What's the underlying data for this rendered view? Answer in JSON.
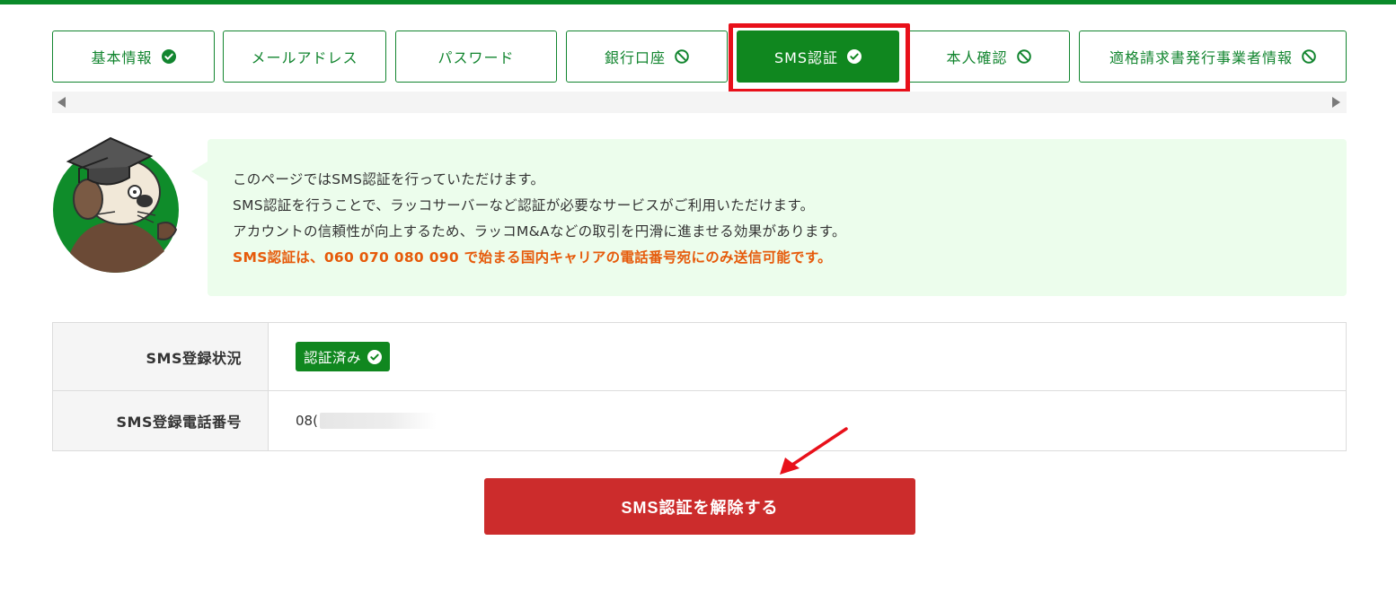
{
  "tabs": [
    {
      "label": "基本情報",
      "status": "check-circle-icon"
    },
    {
      "label": "メールアドレス",
      "status": ""
    },
    {
      "label": "パスワード",
      "status": ""
    },
    {
      "label": "銀行口座",
      "status": "ban-icon"
    },
    {
      "label": "SMS認証",
      "status": "check-circle-icon",
      "active": true
    },
    {
      "label": "本人確認",
      "status": "ban-icon"
    },
    {
      "label": "適格請求書発行事業者情報",
      "status": "ban-icon"
    }
  ],
  "info": {
    "line1": "このページではSMS認証を行っていただけます。",
    "line2": "SMS認証を行うことで、ラッコサーバーなど認証が必要なサービスがご利用いただけます。",
    "line3": "アカウントの信頼性が向上するため、ラッコM&Aなどの取引を円滑に進ませる効果があります。",
    "warning": "SMS認証は、060 070 080 090 で始まる国内キャリアの電話番号宛にのみ送信可能です。"
  },
  "table": {
    "status_label": "SMS登録状況",
    "status_value": "認証済み",
    "phone_label": "SMS登録電話番号",
    "phone_value": "08("
  },
  "action": {
    "unlink_label": "SMS認証を解除する"
  },
  "colors": {
    "brand_green": "#10871f",
    "danger_red": "#cc2c2c",
    "warning_orange": "#e65a0a",
    "info_bg": "#ecfdec"
  }
}
